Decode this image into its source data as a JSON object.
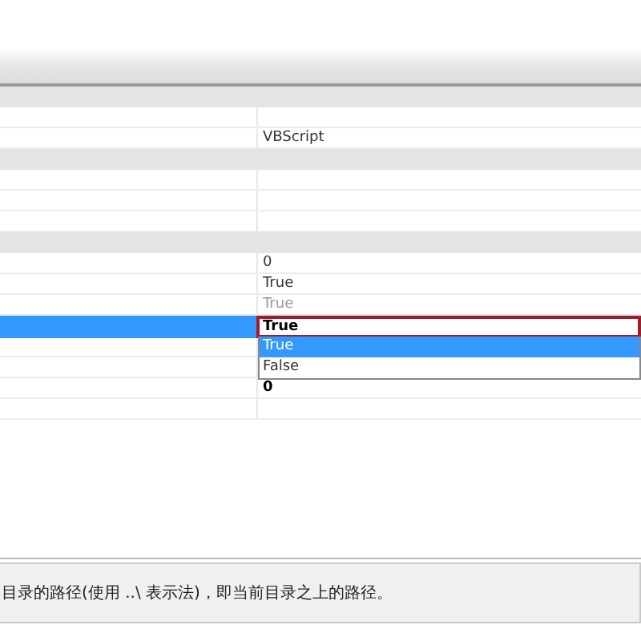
{
  "rows": [
    {
      "kind": "category"
    },
    {
      "kind": "property",
      "selected": false
    },
    {
      "kind": "property",
      "selected": false,
      "value": "VBScript",
      "bold": false,
      "disabled": false
    },
    {
      "kind": "category"
    },
    {
      "kind": "property",
      "selected": false
    },
    {
      "kind": "property",
      "selected": false
    },
    {
      "kind": "property",
      "selected": false
    },
    {
      "kind": "category"
    },
    {
      "kind": "property",
      "selected": false,
      "value": "0",
      "bold": false,
      "disabled": false
    },
    {
      "kind": "property",
      "selected": false,
      "value": "True",
      "bold": false,
      "disabled": false
    },
    {
      "kind": "property",
      "selected": false,
      "value": "True",
      "bold": false,
      "disabled": true
    },
    {
      "kind": "editor",
      "selected": true,
      "value": "True",
      "bold": true,
      "options": [
        {
          "label": "True",
          "selected": true
        },
        {
          "label": "False",
          "selected": false
        }
      ]
    },
    {
      "kind": "property",
      "selected": false
    },
    {
      "kind": "property",
      "selected": false
    },
    {
      "kind": "property",
      "selected": false,
      "value": "0",
      "bold": true,
      "disabled": false
    },
    {
      "kind": "property",
      "selected": false
    }
  ],
  "description": "目录的路径(使用 ..\\ 表示法)，即当前目录之上的路径。"
}
